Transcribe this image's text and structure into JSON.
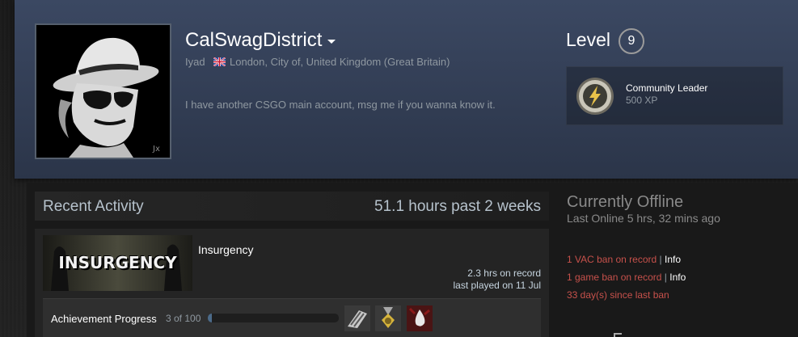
{
  "profile": {
    "persona_name": "CalSwagDistrict",
    "real_name": "Iyad",
    "location": "London, City of, United Kingdom (Great Britain)",
    "summary": "I have another CSGO main account, msg me if you wanna know it."
  },
  "level": {
    "label": "Level",
    "value": "9",
    "badge": {
      "name": "Community Leader",
      "xp": "500 XP",
      "icon": "lightning-badge-icon"
    }
  },
  "recent_activity": {
    "title": "Recent Activity",
    "hours_summary": "51.1 hours past 2 weeks",
    "games": [
      {
        "name": "Insurgency",
        "capsule_text": "INSURGENCY",
        "hours_on_record": "2.3 hrs on record",
        "last_played": "last played on 11 Jul",
        "achievements": {
          "label": "Achievement Progress",
          "count": "3 of 100",
          "progress": 0.03,
          "icons": [
            "ammo-achievement-icon",
            "medal-achievement-icon",
            "blood-drop-achievement-icon"
          ]
        }
      }
    ]
  },
  "status": {
    "title": "Currently Offline",
    "last_online": "Last Online 5 hrs, 32 mins ago"
  },
  "bans": {
    "vac": "1 VAC ban on record",
    "game": "1 game ban on record",
    "since": "33 day(s) since last ban",
    "separator": "|",
    "info_link": "Info"
  },
  "colors": {
    "header_band": "#3b4862",
    "ban_red": "#c7514b",
    "text_muted": "#8f98a0"
  }
}
